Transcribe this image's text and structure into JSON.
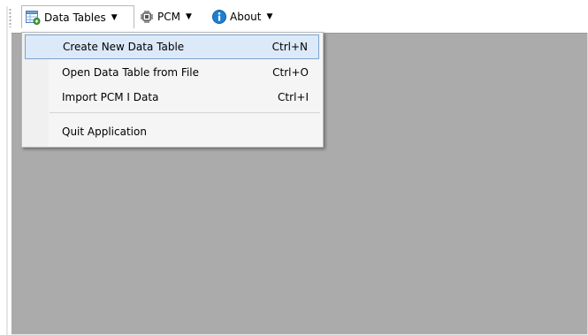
{
  "menubar": {
    "items": [
      {
        "label": "Data Tables",
        "icon": "table-icon"
      },
      {
        "label": "PCM",
        "icon": "chip-icon"
      },
      {
        "label": "About",
        "icon": "info-icon"
      }
    ]
  },
  "dropdown": {
    "items": [
      {
        "label": "Create New Data Table",
        "shortcut": "Ctrl+N",
        "highlighted": true
      },
      {
        "label": "Open Data Table from File",
        "shortcut": "Ctrl+O"
      },
      {
        "label": "Import PCM I Data",
        "shortcut": "Ctrl+I"
      },
      {
        "label": "Quit Application",
        "shortcut": ""
      }
    ]
  },
  "colors": {
    "client_background": "#ababab",
    "highlight_fill": "#dbe9f8",
    "highlight_border": "#7da2ce",
    "info_icon": "#1e7fd0"
  }
}
